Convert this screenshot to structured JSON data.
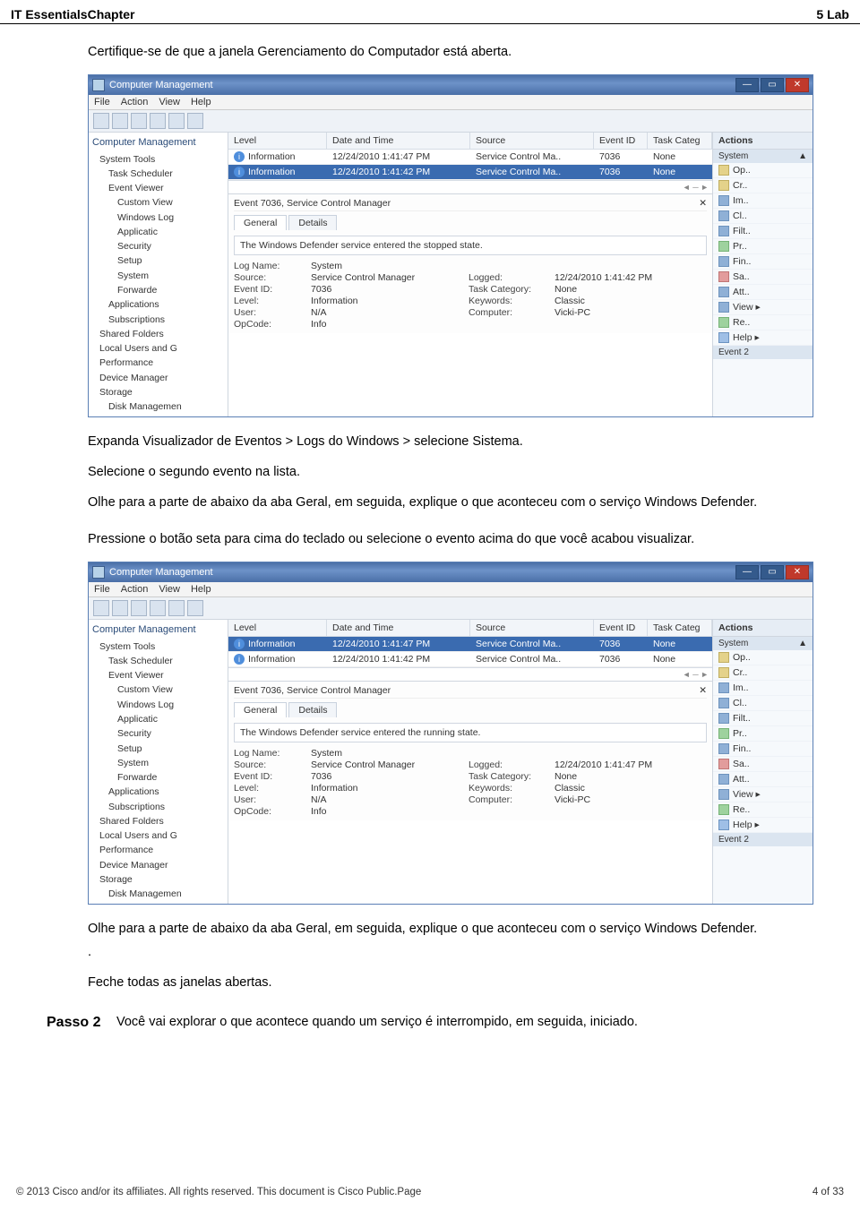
{
  "header": {
    "left": "IT EssentialsChapter",
    "right": "5 Lab"
  },
  "paras": {
    "p1": "Certifique-se de que a janela Gerenciamento do Computador está aberta.",
    "p2": "Expanda Visualizador de Eventos > Logs do Windows > selecione Sistema.",
    "p3": "Selecione o segundo evento na lista.",
    "p4": "Olhe para a parte de abaixo da aba Geral, em seguida, explique o que aconteceu com o serviço Windows Defender.",
    "p5": "Pressione o botão seta para cima do teclado ou selecione o evento acima do que você acabou visualizar.",
    "p6": "Olhe para a parte de abaixo da aba Geral, em seguida, explique o que aconteceu com o serviço Windows Defender.",
    "p6b": ".",
    "p7": "Feche todas as janelas abertas."
  },
  "step2": {
    "label": "Passo 2",
    "text": "Você vai explorar o que acontece quando um serviço é interrompido, em seguida, iniciado."
  },
  "win_common": {
    "title": "Computer Management",
    "menu": [
      "File",
      "Action",
      "View",
      "Help"
    ],
    "tree_header": "Computer Management",
    "tree": [
      {
        "lvl": "lvl1",
        "t": "System Tools"
      },
      {
        "lvl": "lvl2",
        "t": "Task Scheduler"
      },
      {
        "lvl": "lvl2",
        "t": "Event Viewer"
      },
      {
        "lvl": "lvl3",
        "t": "Custom View"
      },
      {
        "lvl": "lvl3",
        "t": "Windows Log"
      },
      {
        "lvl": "lvl3",
        "t": "Applicatic"
      },
      {
        "lvl": "lvl3",
        "t": "Security"
      },
      {
        "lvl": "lvl3",
        "t": "Setup"
      },
      {
        "lvl": "lvl3",
        "t": "System"
      },
      {
        "lvl": "lvl3",
        "t": "Forwarde"
      },
      {
        "lvl": "lvl2",
        "t": "Applications"
      },
      {
        "lvl": "lvl2",
        "t": "Subscriptions"
      },
      {
        "lvl": "lvl1",
        "t": "Shared Folders"
      },
      {
        "lvl": "lvl1",
        "t": "Local Users and G"
      },
      {
        "lvl": "lvl1",
        "t": "Performance"
      },
      {
        "lvl": "lvl1",
        "t": "Device Manager"
      },
      {
        "lvl": "lvl1",
        "t": "Storage"
      },
      {
        "lvl": "lvl2",
        "t": "Disk Managemen"
      }
    ],
    "cols": {
      "level": "Level",
      "dt": "Date and Time",
      "src": "Source",
      "eid": "Event ID",
      "tc": "Task Categ"
    },
    "detail_header_prefix": "Event 7036, Service Control Manager",
    "tabs": {
      "general": "General",
      "details": "Details"
    },
    "prop_keys": {
      "logname": "Log Name:",
      "source": "Source:",
      "eventid": "Event ID:",
      "level": "Level:",
      "user": "User:",
      "opcode": "OpCode:",
      "logged": "Logged:",
      "taskcat": "Task Category:",
      "keywords": "Keywords:",
      "computer": "Computer:"
    },
    "actions_header": "Actions",
    "actions_section": "System",
    "actions_items": [
      "Op..",
      "Cr..",
      "Im..",
      "Cl..",
      "Filt..",
      "Pr..",
      "Fin..",
      "Sa..",
      "Att..",
      "View  ▸",
      "Re..",
      "Help  ▸"
    ],
    "actions_footer": "Event 2"
  },
  "shot1": {
    "rows": [
      {
        "sel": false,
        "level": "Information",
        "dt": "12/24/2010 1:41:47 PM",
        "src": "Service Control Ma..",
        "eid": "7036",
        "tc": "None"
      },
      {
        "sel": true,
        "level": "Information",
        "dt": "12/24/2010 1:41:42 PM",
        "src": "Service Control Ma..",
        "eid": "7036",
        "tc": "None"
      }
    ],
    "msg": "The Windows Defender service entered the stopped state.",
    "props": {
      "logname": "System",
      "source": "Service Control Manager",
      "eventid": "7036",
      "level": "Information",
      "user": "N/A",
      "opcode": "Info",
      "logged": "12/24/2010 1:41:42 PM",
      "taskcat": "None",
      "keywords": "Classic",
      "computer": "Vicki-PC"
    }
  },
  "shot2": {
    "rows": [
      {
        "sel": true,
        "level": "Information",
        "dt": "12/24/2010 1:41:47 PM",
        "src": "Service Control Ma..",
        "eid": "7036",
        "tc": "None"
      },
      {
        "sel": false,
        "level": "Information",
        "dt": "12/24/2010 1:41:42 PM",
        "src": "Service Control Ma..",
        "eid": "7036",
        "tc": "None"
      }
    ],
    "msg": "The Windows Defender service entered the running state.",
    "props": {
      "logname": "System",
      "source": "Service Control Manager",
      "eventid": "7036",
      "level": "Information",
      "user": "N/A",
      "opcode": "Info",
      "logged": "12/24/2010 1:41:47 PM",
      "taskcat": "None",
      "keywords": "Classic",
      "computer": "Vicki-PC"
    }
  },
  "footer": {
    "left": "© 2013 Cisco and/or its affiliates. All rights reserved. This document is Cisco Public.Page",
    "right": "4 of 33"
  }
}
